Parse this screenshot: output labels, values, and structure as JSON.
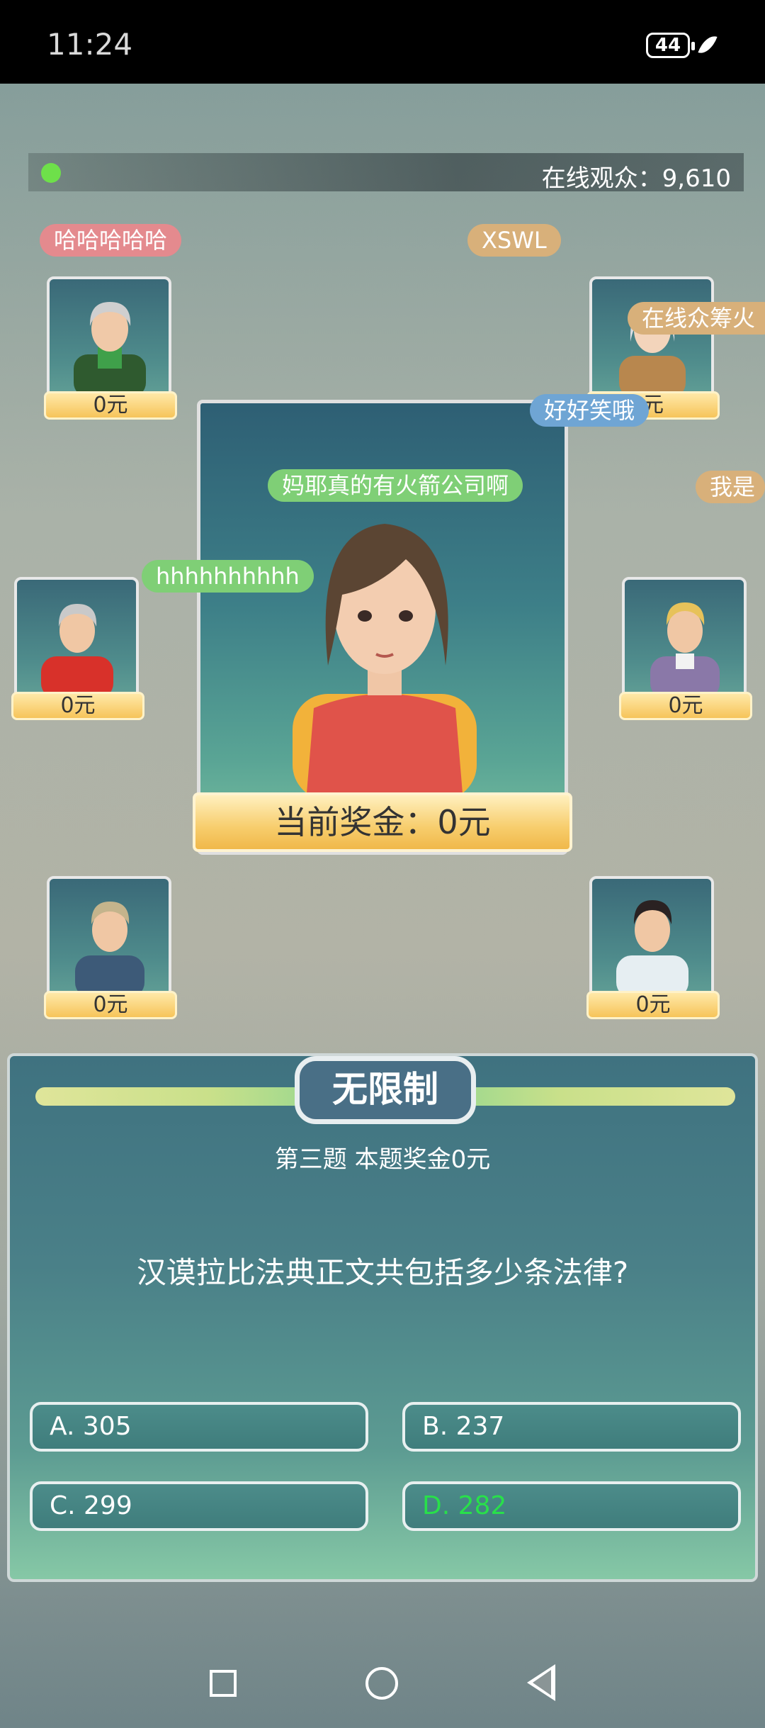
{
  "status": {
    "time": "11:24",
    "battery": "44"
  },
  "viewers": {
    "label": "在线观众：9,610"
  },
  "danmaku": {
    "b1": "哈哈哈哈哈",
    "b2": "XSWL",
    "b3": "在线众筹火",
    "b4": "好好笑哦",
    "b5": "妈耶真的有火箭公司啊",
    "b6": "我是",
    "b7": "hhhhhhhhhh"
  },
  "contestants": [
    {
      "money": "0元"
    },
    {
      "money": "元"
    },
    {
      "money": "0元"
    },
    {
      "money": "0元"
    },
    {
      "money": "0元"
    },
    {
      "money": "0元"
    }
  ],
  "host": {
    "prize": "当前奖金：0元"
  },
  "question": {
    "mode": "无限制",
    "number": "第三题 本题奖金0元",
    "text": "汉谟拉比法典正文共包括多少条法律?",
    "answers": [
      {
        "label": "A. 305"
      },
      {
        "label": "B. 237"
      },
      {
        "label": "C. 299"
      },
      {
        "label": "D. 282"
      }
    ],
    "colors": {
      "correct": "#28e04a"
    }
  },
  "navbar": {
    "icons": [
      "recent-apps-icon",
      "home-icon",
      "back-icon"
    ]
  }
}
